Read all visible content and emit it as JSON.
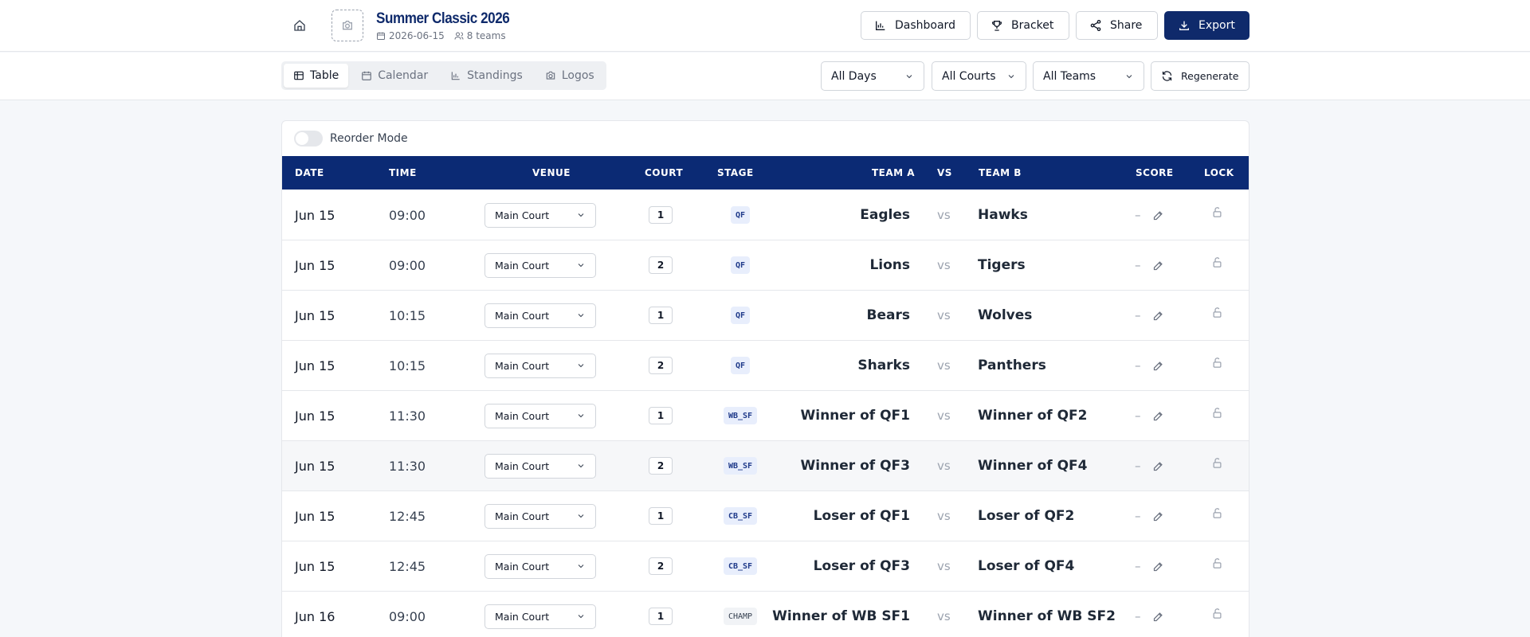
{
  "header": {
    "title": "Summer Classic 2026",
    "date": "2026-06-15",
    "teams": "8 teams",
    "buttons": {
      "dashboard": "Dashboard",
      "bracket": "Bracket",
      "share": "Share",
      "export": "Export"
    }
  },
  "views": {
    "tabs": [
      {
        "label": "Table",
        "icon": "table-icon",
        "active": true
      },
      {
        "label": "Calendar",
        "icon": "calendar-icon",
        "active": false
      },
      {
        "label": "Standings",
        "icon": "bar-chart-icon",
        "active": false
      },
      {
        "label": "Logos",
        "icon": "camera-icon",
        "active": false
      }
    ]
  },
  "filters": {
    "days": "All Days",
    "courts": "All Courts",
    "teams": "All Teams",
    "regenerate": "Regenerate"
  },
  "table": {
    "reorder_label": "Reorder Mode",
    "headers": {
      "date": "DATE",
      "time": "TIME",
      "venue": "VENUE",
      "court": "COURT",
      "stage": "STAGE",
      "team_a": "TEAM A",
      "vs": "VS",
      "team_b": "TEAM B",
      "score": "SCORE",
      "lock": "LOCK"
    },
    "rows": [
      {
        "date": "Jun 15",
        "time": "09:00",
        "venue": "Main Court",
        "court": "1",
        "stage": "QF",
        "team_a": "Eagles",
        "vs": "vs",
        "team_b": "Hawks",
        "score": "–"
      },
      {
        "date": "Jun 15",
        "time": "09:00",
        "venue": "Main Court",
        "court": "2",
        "stage": "QF",
        "team_a": "Lions",
        "vs": "vs",
        "team_b": "Tigers",
        "score": "–"
      },
      {
        "date": "Jun 15",
        "time": "10:15",
        "venue": "Main Court",
        "court": "1",
        "stage": "QF",
        "team_a": "Bears",
        "vs": "vs",
        "team_b": "Wolves",
        "score": "–"
      },
      {
        "date": "Jun 15",
        "time": "10:15",
        "venue": "Main Court",
        "court": "2",
        "stage": "QF",
        "team_a": "Sharks",
        "vs": "vs",
        "team_b": "Panthers",
        "score": "–"
      },
      {
        "date": "Jun 15",
        "time": "11:30",
        "venue": "Main Court",
        "court": "1",
        "stage": "WB_SF",
        "team_a": "Winner of QF1",
        "vs": "vs",
        "team_b": "Winner of QF2",
        "score": "–"
      },
      {
        "date": "Jun 15",
        "time": "11:30",
        "venue": "Main Court",
        "court": "2",
        "stage": "WB_SF",
        "team_a": "Winner of QF3",
        "vs": "vs",
        "team_b": "Winner of QF4",
        "score": "–"
      },
      {
        "date": "Jun 15",
        "time": "12:45",
        "venue": "Main Court",
        "court": "1",
        "stage": "CB_SF",
        "team_a": "Loser of QF1",
        "vs": "vs",
        "team_b": "Loser of QF2",
        "score": "–"
      },
      {
        "date": "Jun 15",
        "time": "12:45",
        "venue": "Main Court",
        "court": "2",
        "stage": "CB_SF",
        "team_a": "Loser of QF3",
        "vs": "vs",
        "team_b": "Loser of QF4",
        "score": "–"
      },
      {
        "date": "Jun 16",
        "time": "09:00",
        "venue": "Main Court",
        "court": "1",
        "stage": "CHAMP",
        "team_a": "Winner of WB SF1",
        "vs": "vs",
        "team_b": "Winner of WB SF2",
        "score": "–"
      }
    ]
  },
  "colors": {
    "brand": "#0f2a6b",
    "header_bg": "#0b2a74",
    "stage_bg": "#e8eefc"
  }
}
